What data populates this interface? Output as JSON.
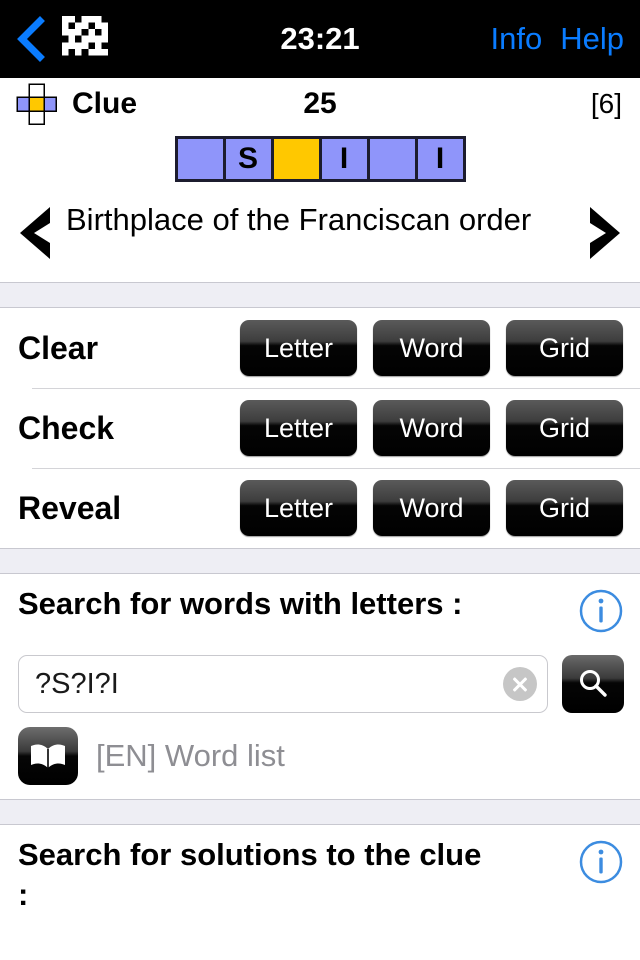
{
  "navbar": {
    "back_icon": "chevron-left-icon",
    "grid_icon": "crossword-grid-icon",
    "clock": "23:21",
    "info_label": "Info",
    "help_label": "Help",
    "link_color": "#0a7cff"
  },
  "clue_header": {
    "cross_icon": "crossword-cursor-icon",
    "label": "Clue",
    "number": "25",
    "length": "[6]"
  },
  "word_grid": {
    "cells": [
      {
        "letter": "",
        "state": "normal"
      },
      {
        "letter": "S",
        "state": "normal"
      },
      {
        "letter": "",
        "state": "active"
      },
      {
        "letter": "I",
        "state": "normal"
      },
      {
        "letter": "",
        "state": "normal"
      },
      {
        "letter": "I",
        "state": "normal"
      }
    ],
    "cell_color": "#8f95fa",
    "active_color": "#ffc800",
    "border_color": "#1c1c2e"
  },
  "clue": {
    "prev_icon": "chevron-left-icon",
    "next_icon": "chevron-right-icon",
    "text": "Birthplace of the Franciscan order"
  },
  "actions": [
    {
      "label": "Clear",
      "buttons": [
        "Letter",
        "Word",
        "Grid"
      ]
    },
    {
      "label": "Check",
      "buttons": [
        "Letter",
        "Word",
        "Grid"
      ]
    },
    {
      "label": "Reveal",
      "buttons": [
        "Letter",
        "Word",
        "Grid"
      ]
    }
  ],
  "word_search": {
    "title": "Search for words with letters :",
    "info_icon": "info-circle-icon",
    "input_value": "?S?I?I",
    "clear_icon": "clear-circle-icon",
    "search_icon": "magnifier-icon",
    "book_icon": "book-icon",
    "wordlist_label": "[EN] Word list"
  },
  "clue_search": {
    "title": "Search for solutions to the clue :",
    "info_icon": "info-circle-icon"
  }
}
